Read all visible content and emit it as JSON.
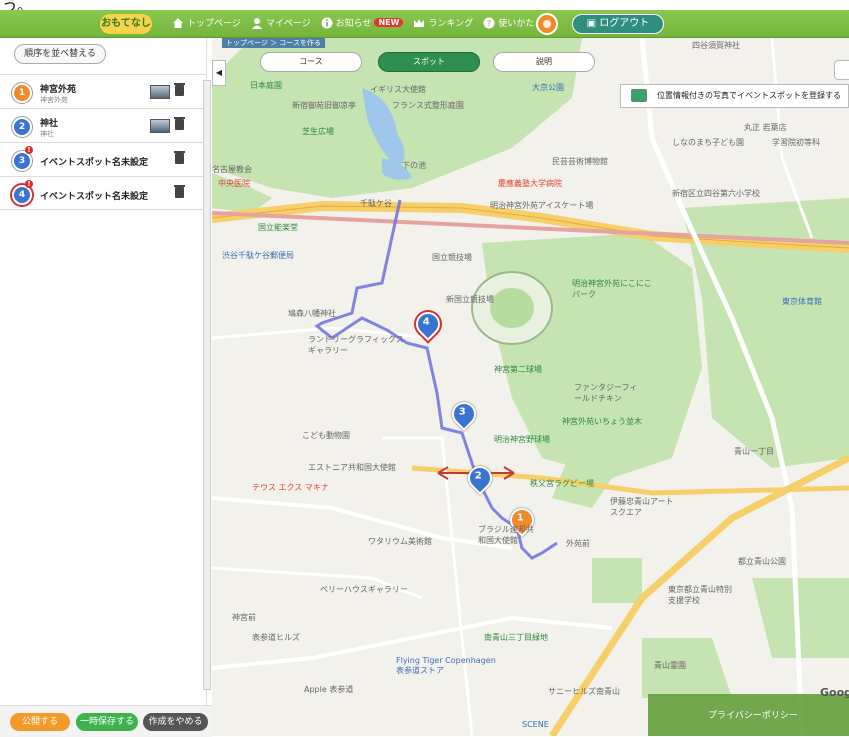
{
  "header": {
    "logo": "おもてなし",
    "nav": [
      {
        "label": "トップページ",
        "icon": "home-icon"
      },
      {
        "label": "マイページ",
        "icon": "user-icon"
      },
      {
        "label": "お知らせ",
        "icon": "info-icon",
        "badge": "NEW"
      },
      {
        "label": "ランキング",
        "icon": "crown-icon"
      },
      {
        "label": "使いかた",
        "icon": "help-icon"
      }
    ],
    "logout_label": "ログアウト"
  },
  "top_fragment": "う。",
  "sidebar": {
    "sort_label": "順序を並べ替える",
    "spots": [
      {
        "num": "1",
        "name": "神宮外苑",
        "sub": "神宮外苑",
        "color": "#f08a2a",
        "alert": false,
        "has_thumb": true
      },
      {
        "num": "2",
        "name": "神社",
        "sub": "神社",
        "color": "#3b73d0",
        "alert": false,
        "has_thumb": true
      },
      {
        "num": "3",
        "name": "イベントスポット名未設定",
        "sub": "",
        "color": "#3b73d0",
        "alert": true,
        "has_thumb": false
      },
      {
        "num": "4",
        "name": "イベントスポット名未設定",
        "sub": "",
        "color": "#3b73d0",
        "alert": true,
        "has_thumb": false
      }
    ],
    "buttons": {
      "publish": "公開する",
      "save_temp": "一時保存する",
      "cancel": "作成をやめる"
    }
  },
  "map": {
    "breadcrumb": "トップページ ＞ コースを作る",
    "tabs": [
      "コース",
      "スポット",
      "説明"
    ],
    "active_tab": 1,
    "photo_register": "位置情報付きの写真でイベントスポットを登録する",
    "labels": [
      "日本庭園",
      "イギリス大使館",
      "大京公園",
      "新宿御苑旧御凉亭",
      "フランス式整形庭園",
      "芝生広場",
      "下の池",
      "しなのまち子ども園",
      "民芸芸術博物館",
      "慶應義塾大学病院",
      "千駄ケ谷",
      "明治神宮外苑アイスケート場",
      "国立能楽堂",
      "国立競技場",
      "新国立競技場",
      "明治神宮外苑にこにこパーク",
      "渋谷千駄ケ谷郵便局",
      "鳩森八幡神社",
      "ランドリーグラフィックスギャラリー",
      "神宮第二球場",
      "ファンタジーフィールドチキン",
      "東京体育館",
      "神宮外苑いちょう並木",
      "明治神宮野球場",
      "こども動物園",
      "エストニア共和国大使館",
      "秩父宮ラグビー場",
      "伊藤忠青山アートスクエア",
      "青山一丁目",
      "ワタリウム美術館",
      "ブラジル連邦共和国大使館",
      "外苑前",
      "ベリーハウスギャラリー",
      "都立青山公園",
      "東京都立青山特別支援学校",
      "表参道ヒルズ",
      "Flying Tiger Copenhagen 表参道ストア",
      "南青山三丁目緑地",
      "神宮前",
      "テウス エクス マキナ",
      "Apple 表参道",
      "サニーヒルズ南青山",
      "SCENE",
      "青山霊園",
      "四谷須賀神社",
      "丸正 若葉店",
      "学習院初等科",
      "新宿区立四谷第六小学校",
      "名古屋教会",
      "中央医院"
    ],
    "policy": "プライバシーポリシー",
    "google": "Google"
  }
}
